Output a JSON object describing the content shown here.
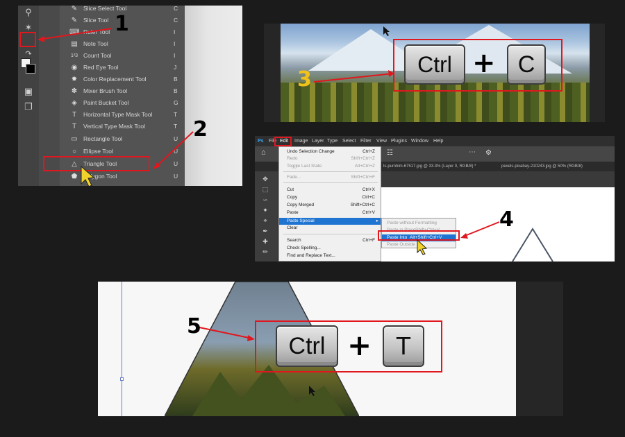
{
  "panel1": {
    "menu_items": [
      {
        "label": "Slice Select Tool",
        "key": "C",
        "icon": "slice-select-icon"
      },
      {
        "label": "Slice Tool",
        "key": "C",
        "icon": "slice-icon"
      },
      {
        "label": "Ruler Tool",
        "key": "I",
        "icon": "ruler-icon"
      },
      {
        "label": "Note Tool",
        "key": "I",
        "icon": "note-icon"
      },
      {
        "label": "Count Tool",
        "key": "I",
        "icon": "count-icon"
      },
      {
        "label": "Red Eye Tool",
        "key": "J",
        "icon": "red-eye-icon"
      },
      {
        "label": "Color Replacement Tool",
        "key": "B",
        "icon": "color-replacement-icon"
      },
      {
        "label": "Mixer Brush Tool",
        "key": "B",
        "icon": "mixer-brush-icon"
      },
      {
        "label": "Paint Bucket Tool",
        "key": "G",
        "icon": "paint-bucket-icon"
      },
      {
        "label": "Horizontal Type Mask Tool",
        "key": "T",
        "icon": "horizontal-type-mask-icon"
      },
      {
        "label": "Vertical Type Mask Tool",
        "key": "T",
        "icon": "vertical-type-mask-icon"
      },
      {
        "label": "Rectangle Tool",
        "key": "U",
        "icon": "rectangle-icon"
      },
      {
        "label": "Ellipse Tool",
        "key": "U",
        "icon": "ellipse-icon"
      },
      {
        "label": "Triangle Tool",
        "key": "U",
        "icon": "triangle-icon"
      },
      {
        "label": "Polygon Tool",
        "key": "U",
        "icon": "polygon-icon"
      }
    ],
    "step": "1",
    "step2": "2"
  },
  "panel2": {
    "step": "3",
    "key1": "Ctrl",
    "plus": "+",
    "key2": "C"
  },
  "panel3": {
    "menubar": [
      "Ps",
      "File",
      "Edit",
      "Image",
      "Layer",
      "Type",
      "Select",
      "Filter",
      "View",
      "Plugins",
      "Window",
      "Help"
    ],
    "tabs": [
      "ls-pumhim-67517.jpg @ 33.3% (Layer 0, RGB/8) *",
      "pexels-pixabay-210243.jpg @ 50% (RGB/8)"
    ],
    "edit_items": [
      {
        "label": "Undo Selection Change",
        "key": "Ctrl+Z",
        "state": "normal"
      },
      {
        "label": "Redo",
        "key": "Shift+Ctrl+Z",
        "state": "disabled"
      },
      {
        "label": "Toggle Last State",
        "key": "Alt+Ctrl+Z",
        "state": "disabled"
      },
      {
        "label": "Fade...",
        "key": "Shift+Ctrl+F",
        "state": "disabled"
      },
      {
        "label": "Cut",
        "key": "Ctrl+X",
        "state": "normal"
      },
      {
        "label": "Copy",
        "key": "Ctrl+C",
        "state": "normal"
      },
      {
        "label": "Copy Merged",
        "key": "Shift+Ctrl+C",
        "state": "normal"
      },
      {
        "label": "Paste",
        "key": "Ctrl+V",
        "state": "normal"
      },
      {
        "label": "Paste Special",
        "key": "",
        "state": "active"
      },
      {
        "label": "Clear",
        "key": "",
        "state": "normal"
      },
      {
        "label": "Search",
        "key": "Ctrl+F",
        "state": "normal"
      },
      {
        "label": "Check Spelling...",
        "key": "",
        "state": "normal"
      },
      {
        "label": "Find and Replace Text...",
        "key": "",
        "state": "normal"
      }
    ],
    "submenu_items": [
      {
        "label": "Paste without Formatting",
        "key": "",
        "state": "disabled"
      },
      {
        "label": "Paste in Place",
        "key": "Shift+Ctrl+V",
        "state": "disabled"
      },
      {
        "label": "Paste Into",
        "key": "Alt+Shift+Ctrl+V",
        "state": "active"
      },
      {
        "label": "Paste Outside",
        "key": "",
        "state": "disabled"
      }
    ],
    "step": "4"
  },
  "panel4": {
    "step": "5",
    "key1": "Ctrl",
    "plus": "+",
    "key2": "T"
  },
  "colors": {
    "highlight_red": "#e0171e",
    "step_yellow": "#f1c21b",
    "menu_active_blue": "#1f73d1"
  }
}
